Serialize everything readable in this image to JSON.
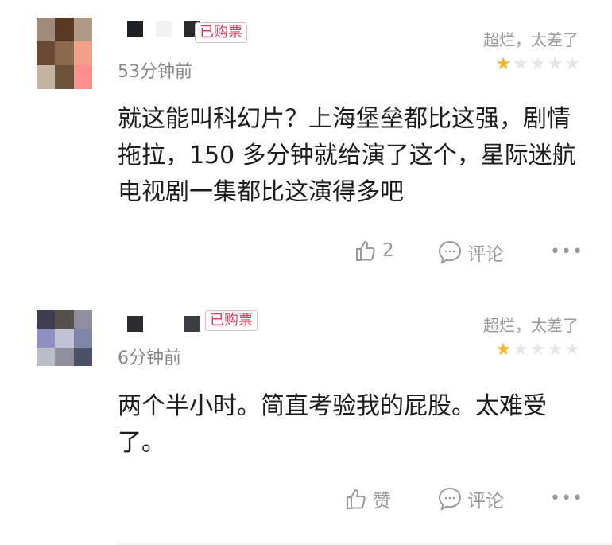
{
  "comments": [
    {
      "badge": "已购票",
      "time": "53分钟前",
      "rating_text": "超烂，太差了",
      "stars_filled": 1,
      "stars_total": 5,
      "text": "就这能叫科幻片？上海堡垒都比这强，剧情拖拉，150 多分钟就给演了这个，星际迷航电视剧一集都比这演得多吧",
      "like_label": "2",
      "reply_label": "评论",
      "more_label": "•••",
      "avatar_colors": [
        "#a08a7a",
        "#5a3a22",
        "#b19a85",
        "#6b4a33",
        "#8c6a50",
        "#f3a08a",
        "#c4b4a4",
        "#6a5238",
        "#ff8f8f"
      ],
      "name_blocks": [
        "#1f2126",
        "#f2f2f2",
        "#2a2b2f"
      ],
      "icons": {
        "like": "thumbs-up-icon",
        "reply": "comment-bubble-icon",
        "more": "more-dots-icon"
      }
    },
    {
      "badge": "已购票",
      "time": "6分钟前",
      "rating_text": "超烂，太差了",
      "stars_filled": 1,
      "stars_total": 5,
      "text": "两个半小时。简直考验我的屁股。太难受了。",
      "like_label": "赞",
      "reply_label": "评论",
      "more_label": "•••",
      "avatar_colors": [
        "#3e3e50",
        "#56504a",
        "#8e8e9c",
        "#8f8fc2",
        "#c2c2d6",
        "#7e86a8",
        "#bbbcc6",
        "#8e8f9a",
        "#4c5064"
      ],
      "name_blocks": [
        "#2b2b2f",
        "#ffffff",
        "#3a3d42"
      ],
      "icons": {
        "like": "thumbs-up-icon",
        "reply": "comment-bubble-icon",
        "more": "more-dots-icon"
      }
    }
  ]
}
